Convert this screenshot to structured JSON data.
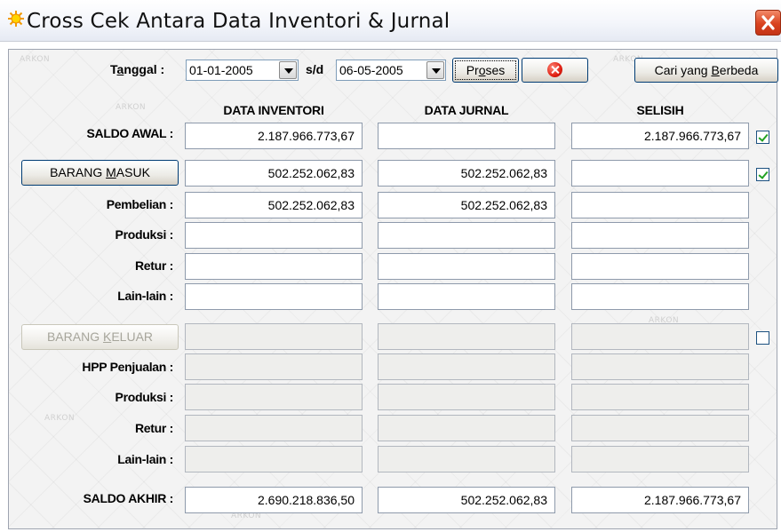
{
  "window": {
    "title": "Cross Cek Antara Data Inventori & Jurnal"
  },
  "filters": {
    "date_label_prefix": "T",
    "date_label_underline": "a",
    "date_label_rest": "nggal :",
    "date_from": "01-01-2005",
    "separator": "s/d",
    "date_to": "06-05-2005",
    "process_prefix": "Pr",
    "process_underline": "o",
    "process_rest": "ses",
    "find_diff_prefix": "Cari yang ",
    "find_diff_underline": "B",
    "find_diff_rest": "erbeda"
  },
  "columns": {
    "inventory": "DATA INVENTORI",
    "journal": "DATA JURNAL",
    "difference": "SELISIH"
  },
  "watermark": "ARKON",
  "rows": {
    "saldo_awal": {
      "label": "SALDO AWAL :",
      "inventory": "2.187.966.773,67",
      "journal": "",
      "difference": "2.187.966.773,67",
      "checked": true
    },
    "barang_masuk": {
      "label_prefix": "BARANG ",
      "label_underline": "M",
      "label_rest": "ASUK",
      "inventory": "502.252.062,83",
      "journal": "502.252.062,83",
      "difference": "",
      "checked": true
    },
    "pembelian": {
      "label": "Pembelian :",
      "inventory": "502.252.062,83",
      "journal": "502.252.062,83",
      "difference": ""
    },
    "produksi_in": {
      "label": "Produksi :",
      "inventory": "",
      "journal": "",
      "difference": ""
    },
    "retur_in": {
      "label": "Retur :",
      "inventory": "",
      "journal": "",
      "difference": ""
    },
    "lain_in": {
      "label": "Lain-lain :",
      "inventory": "",
      "journal": "",
      "difference": ""
    },
    "barang_keluar": {
      "label_prefix": "BARANG ",
      "label_underline": "K",
      "label_rest": "ELUAR",
      "inventory": "",
      "journal": "",
      "difference": "",
      "checked": false
    },
    "hpp_penjualan": {
      "label": "HPP Penjualan :",
      "inventory": "",
      "journal": "",
      "difference": ""
    },
    "produksi_out": {
      "label": "Produksi :",
      "inventory": "",
      "journal": "",
      "difference": ""
    },
    "retur_out": {
      "label": "Retur :",
      "inventory": "",
      "journal": "",
      "difference": ""
    },
    "lain_out": {
      "label": "Lain-lain :",
      "inventory": "",
      "journal": "",
      "difference": ""
    },
    "saldo_akhir": {
      "label": "SALDO AKHIR :",
      "inventory": "2.690.218.836,50",
      "journal": "502.252.062,83",
      "difference": "2.187.966.773,67"
    }
  }
}
